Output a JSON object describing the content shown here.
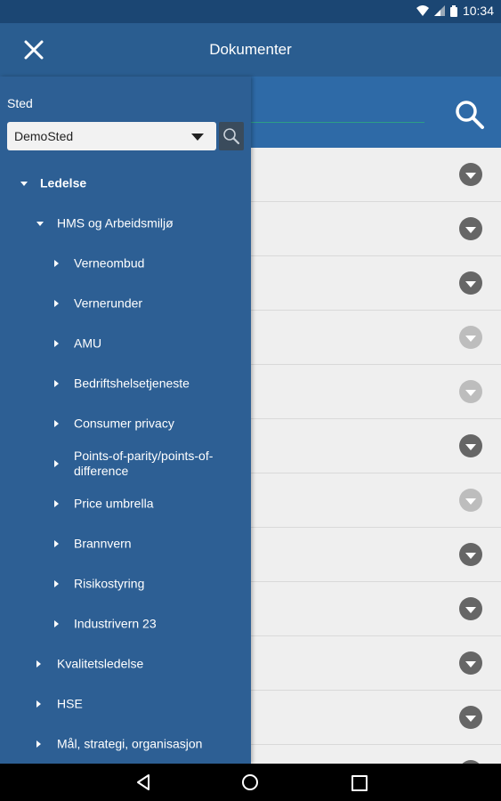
{
  "status_bar": {
    "time": "10:34",
    "icons": [
      "wifi-icon",
      "signal-icon",
      "battery-icon"
    ]
  },
  "app_bar": {
    "title": "Dokumenter",
    "close_icon": "close-icon"
  },
  "drawer": {
    "location_label": "Sted",
    "location_value": "DemoSted",
    "tree": [
      {
        "label": "Ledelse",
        "level": 0,
        "state": "expanded"
      },
      {
        "label": "HMS og Arbeidsmiljø",
        "level": 1,
        "state": "expanded"
      },
      {
        "label": "Verneombud",
        "level": 2,
        "state": "collapsed"
      },
      {
        "label": "Vernerunder",
        "level": 2,
        "state": "collapsed"
      },
      {
        "label": "AMU",
        "level": 2,
        "state": "collapsed"
      },
      {
        "label": "Bedriftshelsetjeneste",
        "level": 2,
        "state": "collapsed"
      },
      {
        "label": "Consumer privacy",
        "level": 2,
        "state": "collapsed"
      },
      {
        "label": "Points-of-parity/points-of-difference",
        "level": 2,
        "state": "collapsed"
      },
      {
        "label": "Price umbrella",
        "level": 2,
        "state": "collapsed"
      },
      {
        "label": "Brannvern",
        "level": 2,
        "state": "collapsed"
      },
      {
        "label": "Risikostyring",
        "level": 2,
        "state": "collapsed"
      },
      {
        "label": "Industrivern 23",
        "level": 2,
        "state": "collapsed"
      },
      {
        "label": "Kvalitetsledelse",
        "level": 1,
        "state": "collapsed"
      },
      {
        "label": "HSE",
        "level": 1,
        "state": "collapsed"
      },
      {
        "label": "Mål, strategi, organisasjon",
        "level": 1,
        "state": "collapsed"
      }
    ]
  },
  "content_rows": [
    {
      "expand_state": "active"
    },
    {
      "expand_state": "active"
    },
    {
      "expand_state": "active"
    },
    {
      "expand_state": "disabled"
    },
    {
      "expand_state": "disabled"
    },
    {
      "expand_state": "active"
    },
    {
      "expand_state": "disabled"
    },
    {
      "expand_state": "active"
    },
    {
      "expand_state": "active"
    },
    {
      "expand_state": "active"
    },
    {
      "expand_state": "active"
    },
    {
      "expand_state": "active"
    }
  ],
  "colors": {
    "status_bar": "#1b4673",
    "app_bar": "#2a5d90",
    "drawer": "#2d5f94",
    "search_strip": "#2e6aa7",
    "accent_line": "#2d9e86"
  },
  "nav_bar": {
    "icons": [
      "back-icon",
      "home-icon",
      "recent-apps-icon"
    ]
  }
}
